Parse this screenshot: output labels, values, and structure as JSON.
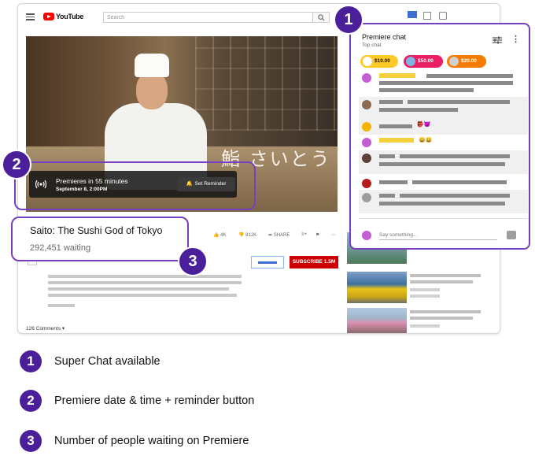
{
  "youtube": {
    "logo_text": "YouTube",
    "search_placeholder": "Search"
  },
  "video": {
    "overlay_jp": "鮨 さいとう",
    "premiere_line": "Premieres in 55 minutes",
    "premiere_date": "September 8, 2:00PM",
    "reminder_label": "Set Reminder"
  },
  "info": {
    "title": "Saito: The Sushi God of Tokyo",
    "waiting": "292,451 waiting",
    "likes": "4K",
    "dislikes": "812K",
    "share": "SHARE",
    "subscribe": "SUBSCRIBE 1.5M",
    "comments": "126 Comments"
  },
  "chat": {
    "title": "Premiere chat",
    "subtitle": "Top chat",
    "superchats": [
      {
        "amount": "$10.00",
        "color": "#ffca28"
      },
      {
        "amount": "$50.00",
        "color": "#e91e63"
      },
      {
        "amount": "$20.00",
        "color": "#f57c00"
      }
    ],
    "input_placeholder": "Say something..."
  },
  "legend": [
    {
      "num": "1",
      "text": "Super Chat available"
    },
    {
      "num": "2",
      "text": "Premiere date & time + reminder button"
    },
    {
      "num": "3",
      "text": "Number of people waiting on Premiere"
    }
  ],
  "colors": {
    "accent_purple": "#7a3fc1",
    "badge_purple": "#4b1f9a",
    "youtube_red": "#ff0000"
  }
}
